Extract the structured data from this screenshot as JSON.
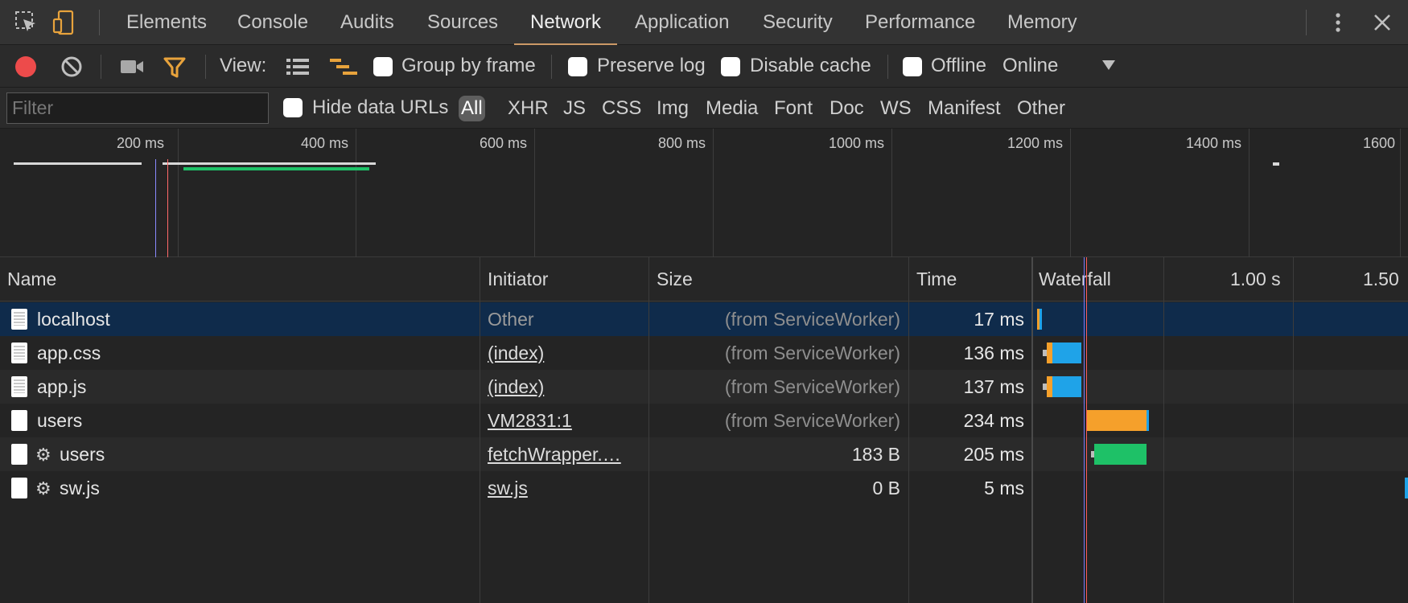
{
  "tabs": [
    "Elements",
    "Console",
    "Audits",
    "Sources",
    "Network",
    "Application",
    "Security",
    "Performance",
    "Memory"
  ],
  "active_tab": "Network",
  "toolbar": {
    "view_label": "View:",
    "group_by_frame": "Group by frame",
    "preserve_log": "Preserve log",
    "disable_cache": "Disable cache",
    "offline": "Offline",
    "throttling": "Online"
  },
  "filter": {
    "placeholder": "Filter",
    "value": "",
    "hide_data_urls": "Hide data URLs",
    "types": [
      "All",
      "XHR",
      "JS",
      "CSS",
      "Img",
      "Media",
      "Font",
      "Doc",
      "WS",
      "Manifest",
      "Other"
    ],
    "active_type": "All"
  },
  "overview": {
    "tick_labels": [
      "200 ms",
      "400 ms",
      "600 ms",
      "800 ms",
      "1000 ms",
      "1200 ms",
      "1400 ms",
      "1600"
    ]
  },
  "table": {
    "headers": {
      "name": "Name",
      "initiator": "Initiator",
      "size": "Size",
      "time": "Time",
      "waterfall": "Waterfall",
      "wf_tick_1": "1.00 s",
      "wf_tick_2": "1.50"
    },
    "rows": [
      {
        "name": "localhost",
        "initiator": "Other",
        "size": "(from ServiceWorker)",
        "time": "17 ms",
        "selected": true
      },
      {
        "name": "app.css",
        "initiator": "(index)",
        "size": "(from ServiceWorker)",
        "time": "136 ms"
      },
      {
        "name": "app.js",
        "initiator": "(index)",
        "size": "(from ServiceWorker)",
        "time": "137 ms"
      },
      {
        "name": "users",
        "initiator": "VM2831:1",
        "size": "(from ServiceWorker)",
        "time": "234 ms"
      },
      {
        "name": "users",
        "initiator": "fetchWrapper.…",
        "size": "183 B",
        "time": "205 ms",
        "gear": true
      },
      {
        "name": "sw.js",
        "initiator": "sw.js",
        "size": "0 B",
        "time": "5 ms",
        "gear": true
      }
    ]
  },
  "colors": {
    "record": "#ed4b4b",
    "filter_icon": "#e8a33c",
    "active_tab_underline": "#cc9966",
    "selected_row": "#0f2b4b",
    "waterfall_blue": "#1fa3e8",
    "waterfall_orange": "#f5a02b",
    "waterfall_green": "#1ec167"
  },
  "icons": [
    "inspect-element-icon",
    "device-toolbar-icon",
    "more-vert-icon",
    "close-icon",
    "record-icon",
    "clear-icon",
    "capture-screenshots-icon",
    "filter-icon",
    "list-view-icon",
    "waterfall-view-icon",
    "dropdown-arrow-icon",
    "document-icon",
    "gear-icon"
  ]
}
